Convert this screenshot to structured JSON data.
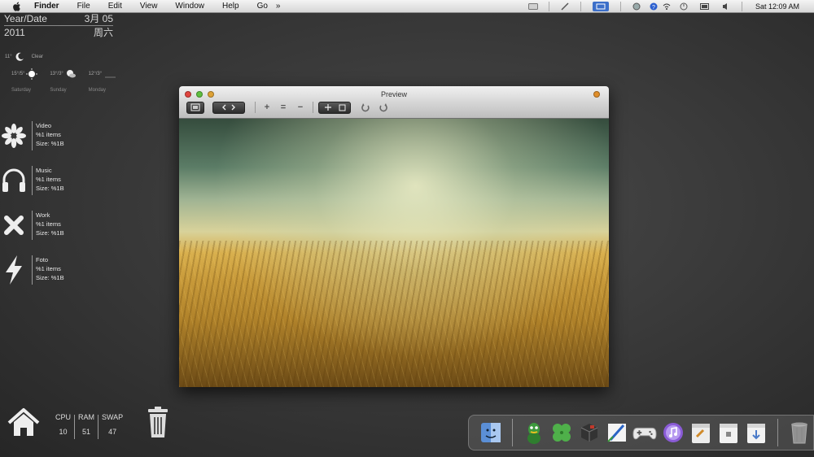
{
  "menubar": {
    "items": [
      "Finder",
      "File",
      "Edit",
      "View",
      "Window",
      "Help",
      "Go"
    ],
    "overflow": "»",
    "clock": "Sat 12:09 AM"
  },
  "date_widget": {
    "year_label": "Year/Date",
    "date": "3月 05",
    "year": "2011",
    "weekday": "周六"
  },
  "weather": {
    "current_temp": "11°",
    "current_condition": "Clear",
    "forecast": [
      {
        "temps": "15°/5°",
        "day": "Saturday",
        "icon": "sun-icon"
      },
      {
        "temps": "13°/3°",
        "day": "Sunday",
        "icon": "partly-cloudy-icon"
      },
      {
        "temps": "12°/3°",
        "day": "Monday",
        "icon": "cloud-icon"
      }
    ]
  },
  "folders": [
    {
      "name": "Video",
      "items": "%1 items",
      "size": "Size: %1B",
      "icon": "flower-icon"
    },
    {
      "name": "Music",
      "items": "%1 items",
      "size": "Size: %1B",
      "icon": "headphones-icon"
    },
    {
      "name": "Work",
      "items": "%1 items",
      "size": "Size: %1B",
      "icon": "x-icon"
    },
    {
      "name": "Foto",
      "items": "%1 items",
      "size": "Size: %1B",
      "icon": "lightning-icon"
    }
  ],
  "stats": [
    {
      "label": "CPU",
      "value": "10"
    },
    {
      "label": "RAM",
      "value": "51"
    },
    {
      "label": "SWAP",
      "value": "47"
    }
  ],
  "preview": {
    "title": "Preview",
    "zoom_in": "+",
    "zoom_actual": "=",
    "zoom_out": "−"
  },
  "dock": {
    "items": [
      "finder-icon",
      "qq-icon",
      "clover-icon",
      "game-cube-icon",
      "pen-tool-icon",
      "gamepad-icon",
      "itunes-icon",
      "notes-icon",
      "app-box-icon",
      "installer-icon"
    ],
    "trash": "trash-icon"
  },
  "colors": {
    "menubar": "#e6e6e6",
    "desktop": "#3a3a3a",
    "close": "#e0443e",
    "minimize": "#dea236",
    "zoom": "#5fbf3f"
  }
}
